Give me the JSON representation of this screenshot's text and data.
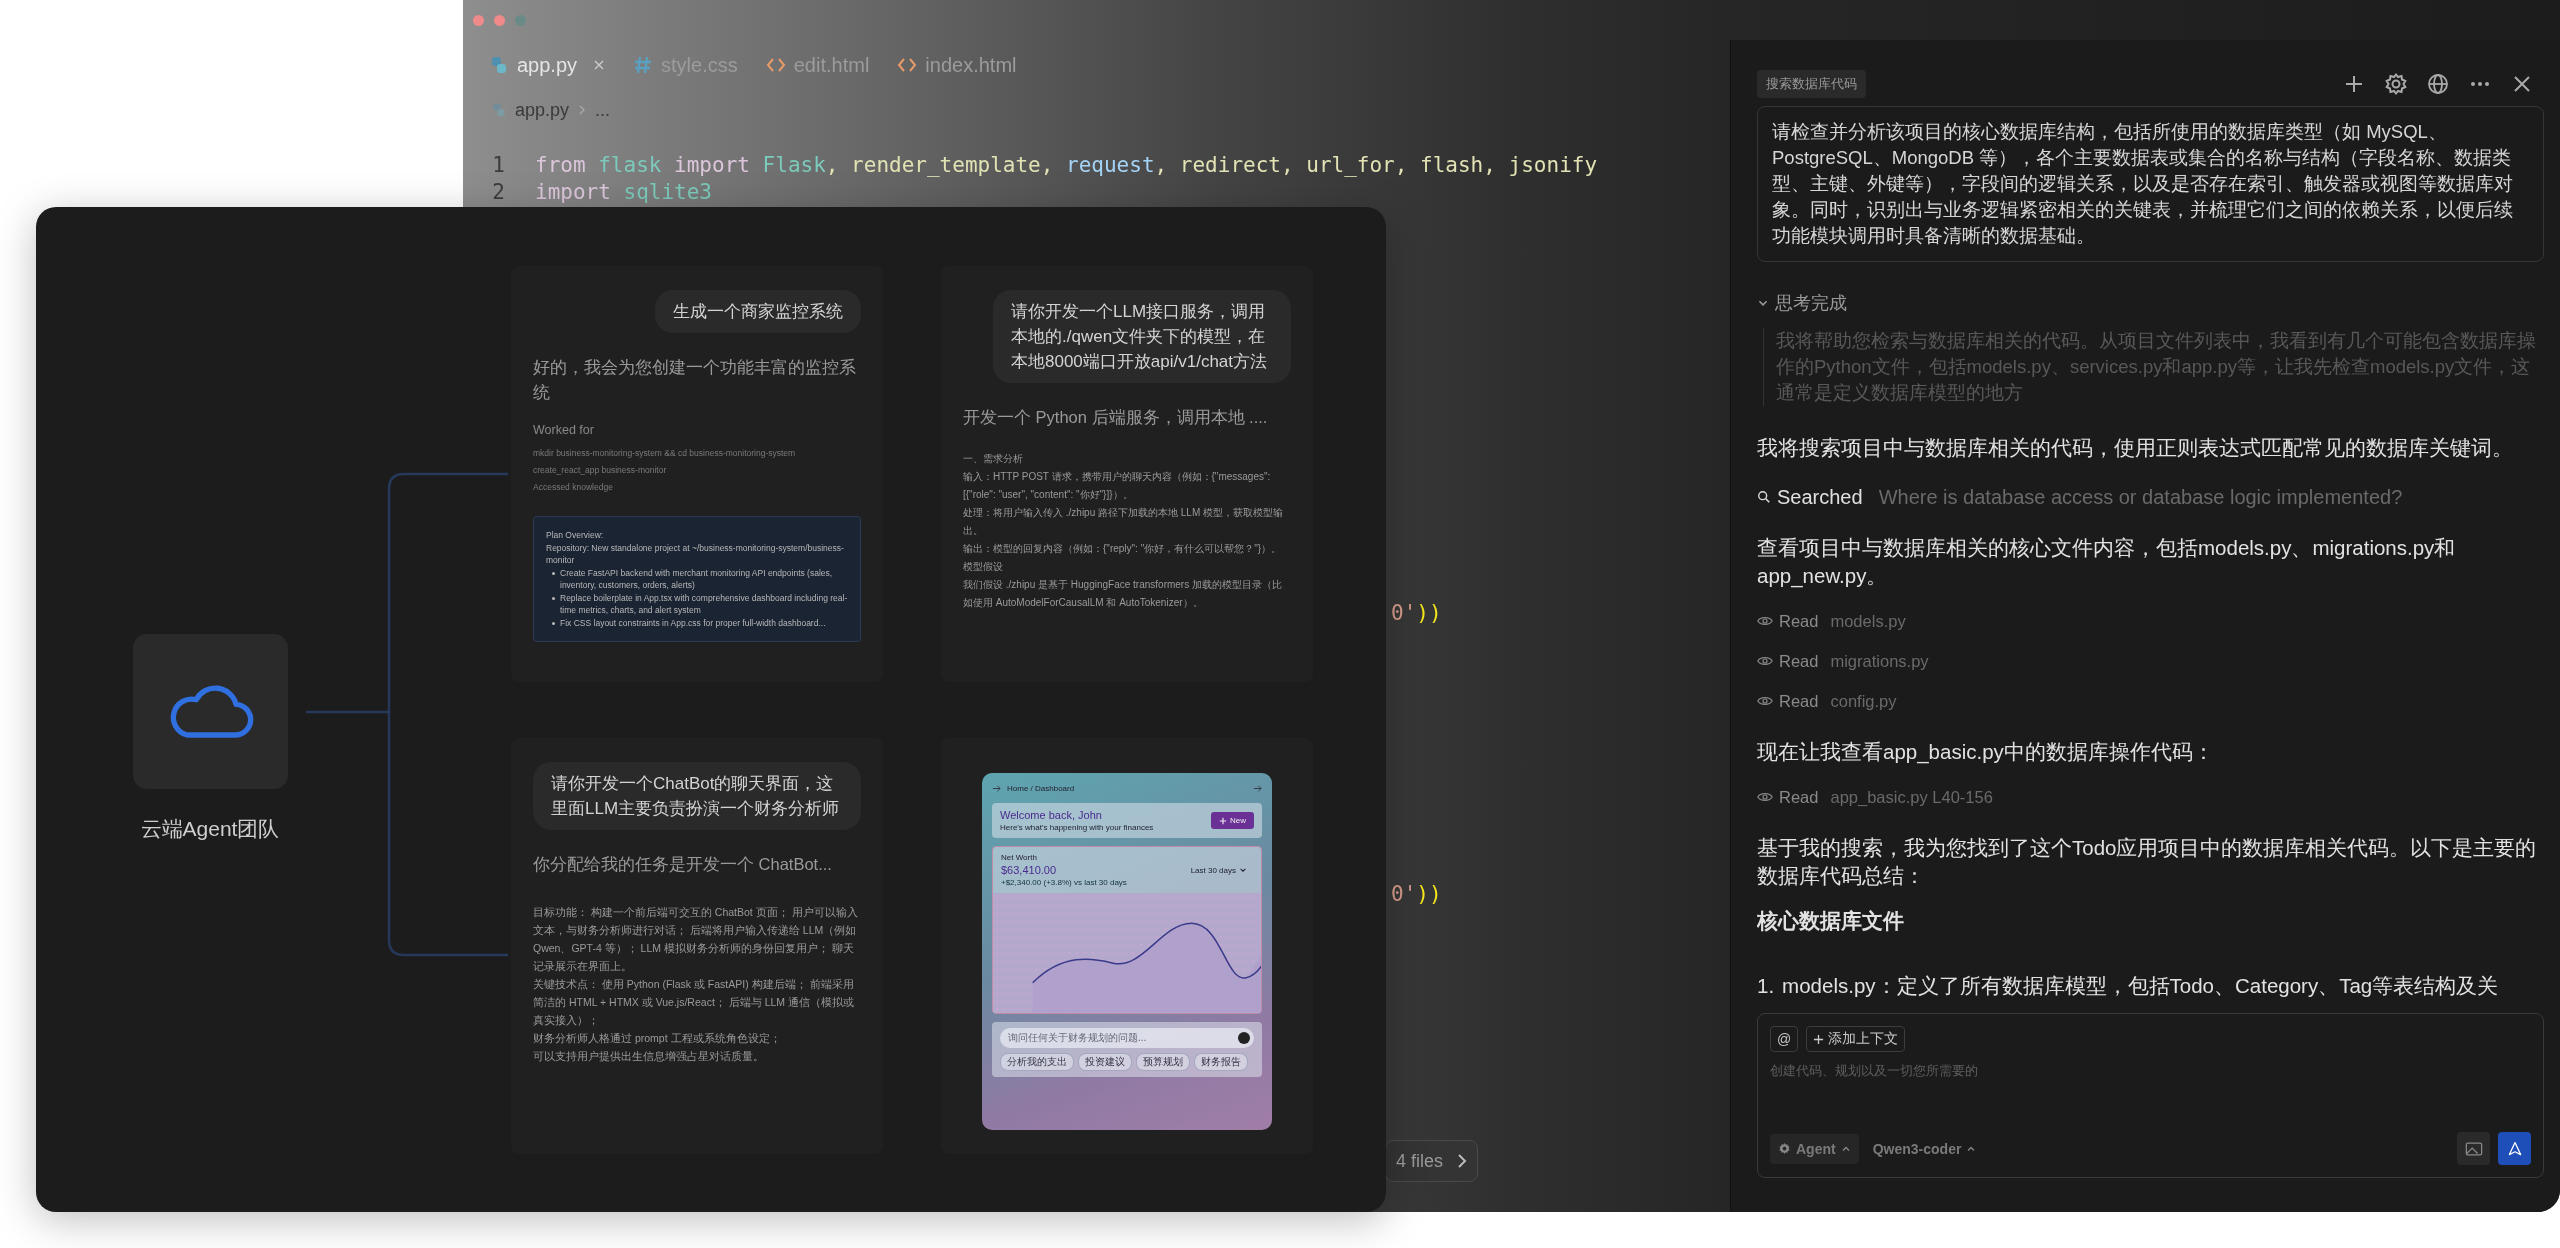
{
  "editor": {
    "tabs": [
      {
        "label": "app.py",
        "kind": "python",
        "selected": true
      },
      {
        "label": "style.css",
        "kind": "css",
        "selected": false
      },
      {
        "label": "edit.html",
        "kind": "html",
        "selected": false
      },
      {
        "label": "index.html",
        "kind": "html",
        "selected": false
      }
    ],
    "breadcrumb": [
      "app.py",
      "..."
    ],
    "code_lines": [
      {
        "number": "1",
        "tokens": [
          {
            "kind": "keyword",
            "text": "from "
          },
          {
            "kind": "module",
            "text": "flask "
          },
          {
            "kind": "keyword",
            "text": "import "
          },
          {
            "kind": "module",
            "text": "Flask"
          },
          {
            "kind": "func",
            "text": ", render_template, "
          },
          {
            "kind": "var",
            "text": "request"
          },
          {
            "kind": "func",
            "text": ", redirect, url_for, flash, jsonify"
          }
        ]
      },
      {
        "number": "2",
        "tokens": [
          {
            "kind": "keyword",
            "text": "import "
          },
          {
            "kind": "module",
            "text": "sqlite3"
          }
        ]
      }
    ],
    "fragments": [
      {
        "tokens": [
          {
            "kind": "string",
            "text": "0'"
          },
          {
            "kind": "bracket",
            "text": "))"
          }
        ]
      },
      {
        "tokens": [
          {
            "kind": "string",
            "text": "0'"
          },
          {
            "kind": "bracket",
            "text": "))"
          }
        ]
      }
    ],
    "files_button": "4 files"
  },
  "chat": {
    "title_tag": "搜索数据库代码",
    "prompt": "请检查并分析该项目的核心数据库结构，包括所使用的数据库类型（如 MySQL、PostgreSQL、MongoDB 等），各个主要数据表或集合的名称与结构（字段名称、数据类型、主键、外键等），字段间的逻辑关系，以及是否存在索引、触发器或视图等数据库对象。同时，识别出与业务逻辑紧密相关的关键表，并梳理它们之间的依赖关系，以便后续功能模块调用时具备清晰的数据基础。",
    "thinking": {
      "label": "思考完成",
      "expanded": true,
      "text": "我将帮助您检索与数据库相关的代码。从项目文件列表中，我看到有几个可能包含数据库操作的Python文件，包括models.py、services.py和app.py等，让我先检查models.py文件，这通常是定义数据库模型的地方"
    },
    "items": [
      {
        "kind": "text",
        "text": "我将搜索项目中与数据库相关的代码，使用正则表达式匹配常见的数据库关键词。"
      },
      {
        "kind": "search",
        "label": "Searched",
        "query": "Where is database access or database logic implemented?"
      },
      {
        "kind": "text",
        "text": "查看项目中与数据库相关的核心文件内容，包括models.py、migrations.py和app_new.py。"
      },
      {
        "kind": "read",
        "label": "Read",
        "file": "models.py"
      },
      {
        "kind": "read",
        "label": "Read",
        "file": "migrations.py"
      },
      {
        "kind": "read",
        "label": "Read",
        "file": "config.py"
      },
      {
        "kind": "text",
        "text": "现在让我查看app_basic.py中的数据库操作代码："
      },
      {
        "kind": "read",
        "label": "Read",
        "file": "app_basic.py L40-156"
      },
      {
        "kind": "text",
        "text": "基于我的搜索，我为您找到了这个Todo应用项目中的数据库相关代码。以下是主要的数据库代码总结："
      },
      {
        "kind": "heading",
        "text": "核心数据库文件"
      },
      {
        "kind": "list_item",
        "number": "1.",
        "text": "models.py：定义了所有数据库模型，包括Todo、Category、Tag等表结构及关"
      }
    ],
    "composer": {
      "mention": "@",
      "add_context": "添加上下文",
      "placeholder": "创建代码、规划以及一切您所需要的",
      "mode": "Agent",
      "model": "Qwen3-coder"
    }
  },
  "team": {
    "label": "云端Agent团队",
    "cards": [
      {
        "kind": "chat",
        "request": "生成一个商家监控系统",
        "reply": "好的，我会为您创建一个功能丰富的监控系统",
        "worked_for": "Worked for",
        "steps": [
          "mkdir business-monitoring-system && cd business-monitoring-system",
          "create_react_app business-monitor",
          "Accessed knowledge"
        ],
        "plan": {
          "title": "Plan Overview:",
          "intro": "Repository: New standalone project at ~/business-monitoring-system/business-monitor",
          "bullets": [
            "Create FastAPI backend with merchant monitoring API endpoints (sales, inventory, customers, orders, alerts)",
            "Replace boilerplate in App.tsx with comprehensive dashboard including real-time metrics, charts, and alert system",
            "Fix CSS layout constraints in App.css for proper full-width dashboard..."
          ]
        }
      },
      {
        "kind": "chat",
        "request": "请你开发一个LLM接口服务，调用本地的./qwen文件夹下的模型，在本地8000端口开放api/v1/chat方法",
        "reply": "开发一个 Python 后端服务，调用本地 ....",
        "body": [
          "一、需求分析",
          "输入：HTTP POST 请求，携带用户的聊天内容（例如：{\"messages\": [{\"role\": \"user\", \"content\": \"你好\"}]}）。",
          "处理：将用户输入传入 ./zhipu 路径下加载的本地 LLM 模型，获取模型输出。",
          "输出：模型的回复内容（例如：{\"reply\": \"你好，有什么可以帮您？\"}）。",
          "模型假设",
          " 我们假设 ./zhipu 是基于 HuggingFace transformers 加载的模型目录（比如使用 AutoModelForCausalLM 和 AutoTokenizer）。"
        ]
      },
      {
        "kind": "chat",
        "request": "请你开发一个ChatBot的聊天界面，这里面LLM主要负责扮演一个财务分析师",
        "reply": "你分配给我的任务是开发一个 ChatBot...",
        "body": [
          "目标功能： 构建一个前后端可交互的 ChatBot 页面； 用户可以输入文本，与财务分析师进行对话； 后端将用户输入传递给 LLM（例如 Qwen、GPT-4 等）； LLM 模拟财务分析师的身份回复用户； 聊天记录展示在界面上。",
          "关键技术点： 使用 Python (Flask 或 FastAPI) 构建后端； 前端采用简洁的 HTML + HTMX 或 Vue.js/React； 后端与 LLM 通信（模拟或真实接入）；",
          "财务分析师人格通过 prompt 工程或系统角色设定；",
          "可以支持用户提供出生信息增强占星对话质量。"
        ]
      },
      {
        "kind": "preview",
        "preview": {
          "breadcrumb": "Home / Dashboard",
          "welcome": "Welcome back, John",
          "subtitle": "Here's what's happening with your finances",
          "new_button": "New",
          "net_worth_label": "Net Worth",
          "net_worth": "$63,410.00",
          "range": "Last 30 days",
          "change": "+$2,340.00 (+3.8%) vs last 30 days",
          "ask_placeholder": "询问任何关于财务规划的问题...",
          "chips": [
            "分析我的支出",
            "投资建议",
            "预算规划",
            "财务报告"
          ]
        }
      }
    ]
  }
}
